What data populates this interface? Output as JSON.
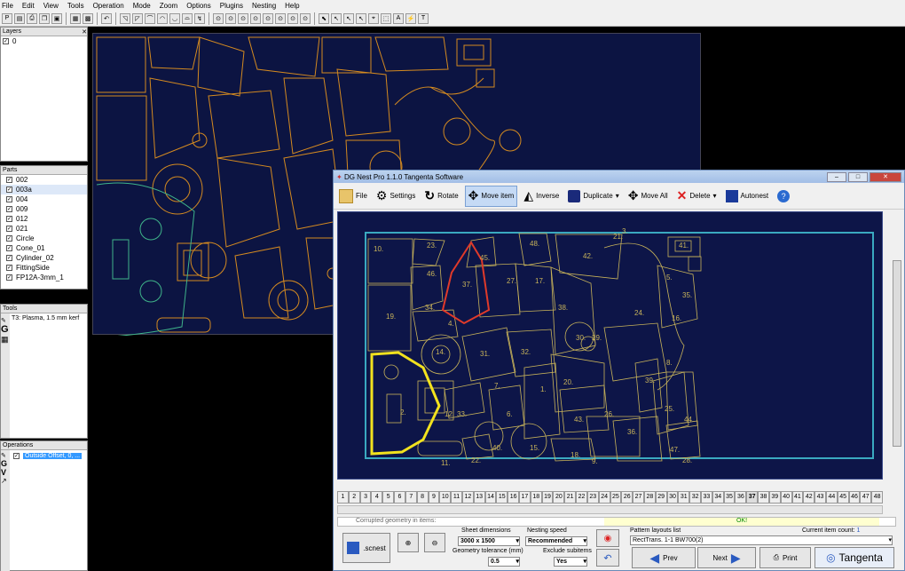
{
  "menu": [
    "File",
    "Edit",
    "View",
    "Tools",
    "Operation",
    "Mode",
    "Zoom",
    "Options",
    "Plugins",
    "Nesting",
    "Help"
  ],
  "layers": {
    "title": "Layers",
    "items": [
      "0"
    ]
  },
  "parts": {
    "title": "Parts",
    "items": [
      "002",
      "003a",
      "004",
      "009",
      "012",
      "021",
      "Circle",
      "Cone_01",
      "Cylinder_02",
      "FittingSide",
      "FP12A-3mm_1"
    ]
  },
  "tools": {
    "title": "Tools",
    "value": "T3: Plasma, 1.5 mm kerf"
  },
  "operations": {
    "title": "Operations",
    "value": "Outside Offset, 0, ..."
  },
  "dialog": {
    "title": "DG Nest Pro 1.1.0   Tangenta Software",
    "buttons": {
      "file": "File",
      "settings": "Settings",
      "rotate": "Rotate",
      "move_item": "Move item",
      "inverse": "Inverse",
      "duplicate": "Duplicate",
      "move_all": "Move All",
      "delete": "Delete",
      "autonest": "Autonest"
    },
    "pages": [
      "1",
      "2",
      "3",
      "4",
      "5",
      "6",
      "7",
      "8",
      "9",
      "10",
      "11",
      "12",
      "13",
      "14",
      "15",
      "16",
      "17",
      "18",
      "19",
      "20",
      "21",
      "22",
      "23",
      "24",
      "25",
      "26",
      "27",
      "28",
      "29",
      "30",
      "31",
      "32",
      "33",
      "34",
      "35",
      "36",
      "37",
      "38",
      "39",
      "40",
      "41",
      "42",
      "43",
      "44",
      "45",
      "46",
      "47",
      "48"
    ],
    "current_page": "37",
    "status_left": "Corrupted geometry in items:",
    "status_right": "OK!",
    "scnest": ".scnest",
    "sheet_dimensions_label": "Sheet dimensions",
    "sheet_dimensions": "3000 x 1500",
    "geometry_tol_label": "Geometry tolerance (mm)",
    "geometry_tol": "0.5",
    "nesting_speed_label": "Nesting speed",
    "nesting_speed": "Recommended",
    "exclude_label": "Exclude subitems",
    "exclude": "Yes",
    "pattern_label": "Pattern layouts list",
    "pattern": "RectTrans. 1-1 BW700(2)",
    "current_count_label": "Current item count:",
    "current_count": "1",
    "prev": "Prev",
    "next": "Next",
    "print": "Print",
    "brand": "Tangenta"
  },
  "nest_labels": [
    "10.",
    "23.",
    "45.",
    "48.",
    "42.",
    "41.",
    "21.",
    "46.",
    "37.",
    "27.",
    "17.",
    "5.",
    "35.",
    "19.",
    "34.",
    "38.",
    "24.",
    "16.",
    "4.",
    "30.",
    "29.",
    "14.",
    "31.",
    "32.",
    "8.",
    "7.",
    "1.",
    "20.",
    "39.",
    "2.",
    "12.",
    "33.",
    "6.",
    "43.",
    "26.",
    "25.",
    "44.",
    "36.",
    "40.",
    "15.",
    "18.",
    "9.",
    "47.",
    "28.",
    "11.",
    "22.",
    "3."
  ],
  "colors": {
    "canvas": "#0c1442",
    "nest_bg": "#0d1548",
    "orange": "#d48a20",
    "yellow": "#f2e21e",
    "red": "#e03a2a",
    "teal": "#3aa9c0",
    "part_line": "#c9b45a"
  }
}
